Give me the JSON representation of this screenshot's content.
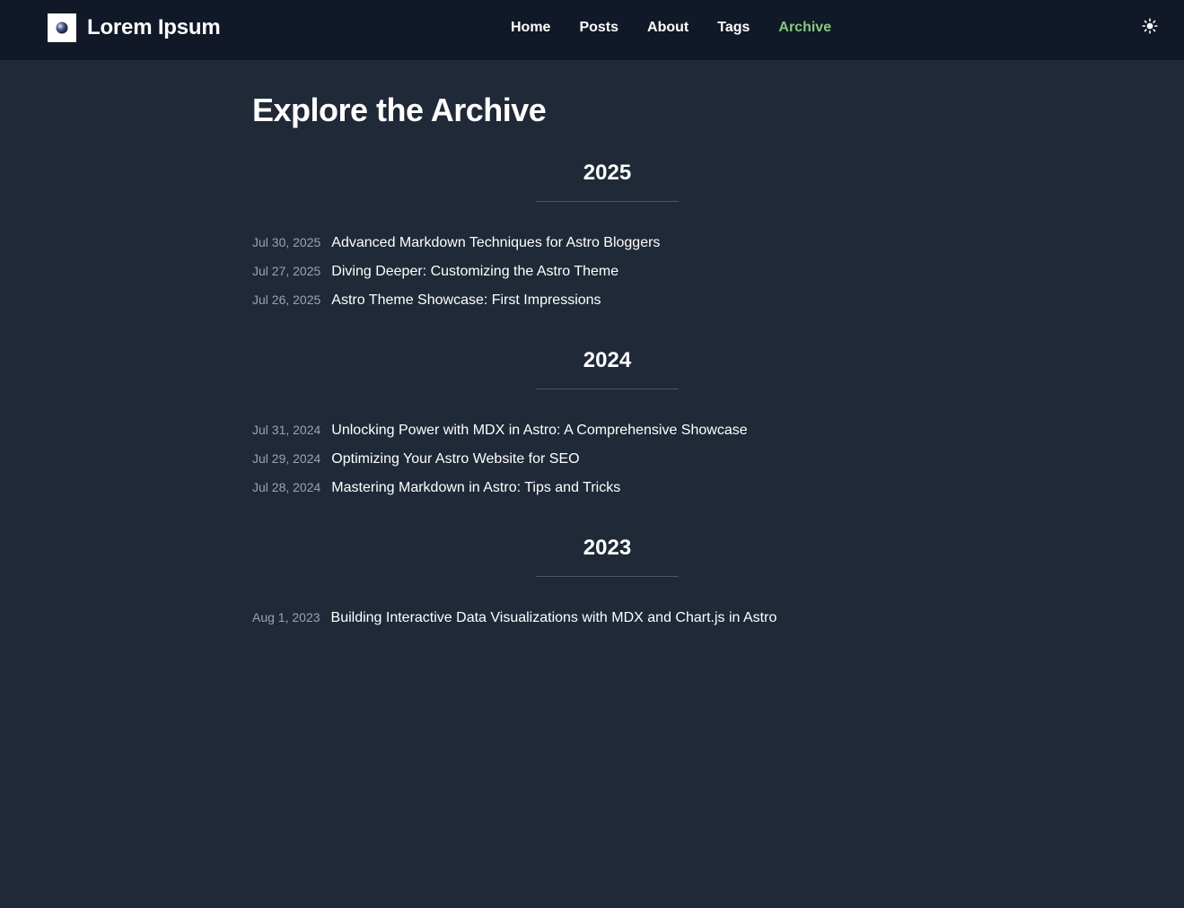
{
  "header": {
    "site_title": "Lorem Ipsum",
    "logo_icon": "logo-sphere-icon",
    "theme_toggle_icon": "sun-icon",
    "nav": [
      {
        "label": "Home",
        "active": false
      },
      {
        "label": "Posts",
        "active": false
      },
      {
        "label": "About",
        "active": false
      },
      {
        "label": "Tags",
        "active": false
      },
      {
        "label": "Archive",
        "active": true
      }
    ],
    "active_color": "#86c97e"
  },
  "main": {
    "title": "Explore the Archive",
    "years": [
      {
        "year": "2025",
        "posts": [
          {
            "date": "Jul 30, 2025",
            "title": "Advanced Markdown Techniques for Astro Bloggers"
          },
          {
            "date": "Jul 27, 2025",
            "title": "Diving Deeper: Customizing the Astro Theme"
          },
          {
            "date": "Jul 26, 2025",
            "title": "Astro Theme Showcase: First Impressions"
          }
        ]
      },
      {
        "year": "2024",
        "posts": [
          {
            "date": "Jul 31, 2024",
            "title": "Unlocking Power with MDX in Astro: A Comprehensive Showcase"
          },
          {
            "date": "Jul 29, 2024",
            "title": "Optimizing Your Astro Website for SEO"
          },
          {
            "date": "Jul 28, 2024",
            "title": "Mastering Markdown in Astro: Tips and Tricks"
          }
        ]
      },
      {
        "year": "2023",
        "posts": [
          {
            "date": "Aug 1, 2023",
            "title": "Building Interactive Data Visualizations with MDX and Chart.js in Astro"
          }
        ]
      }
    ]
  },
  "colors": {
    "background": "#1f2937",
    "header_background": "#111827",
    "muted_text": "#9ca3af",
    "divider": "#4b5563"
  }
}
